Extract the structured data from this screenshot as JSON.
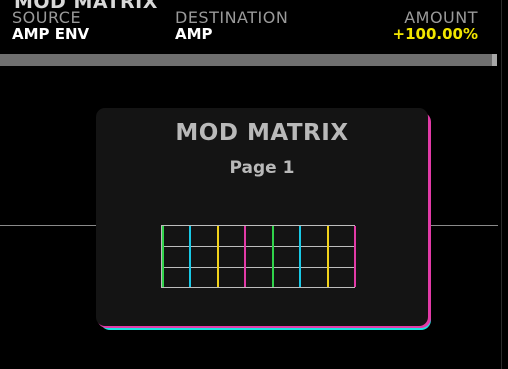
{
  "header": {
    "title": "MOD MATRIX",
    "source_label": "SOURCE",
    "source_value": "AMP ENV",
    "destination_label": "DESTINATION",
    "destination_value": "AMP",
    "amount_label": "AMOUNT",
    "amount_value": "+100.00%"
  },
  "popup": {
    "title": "MOD MATRIX",
    "subtitle": "Page 1"
  },
  "colors": {
    "amount": "#f2e600",
    "grid_column_colors": [
      "#30d24a",
      "#19c9e6",
      "#f2d21a",
      "#e23aa7",
      "#30d24a",
      "#19c9e6",
      "#f2d21a",
      "#e23aa7"
    ]
  }
}
